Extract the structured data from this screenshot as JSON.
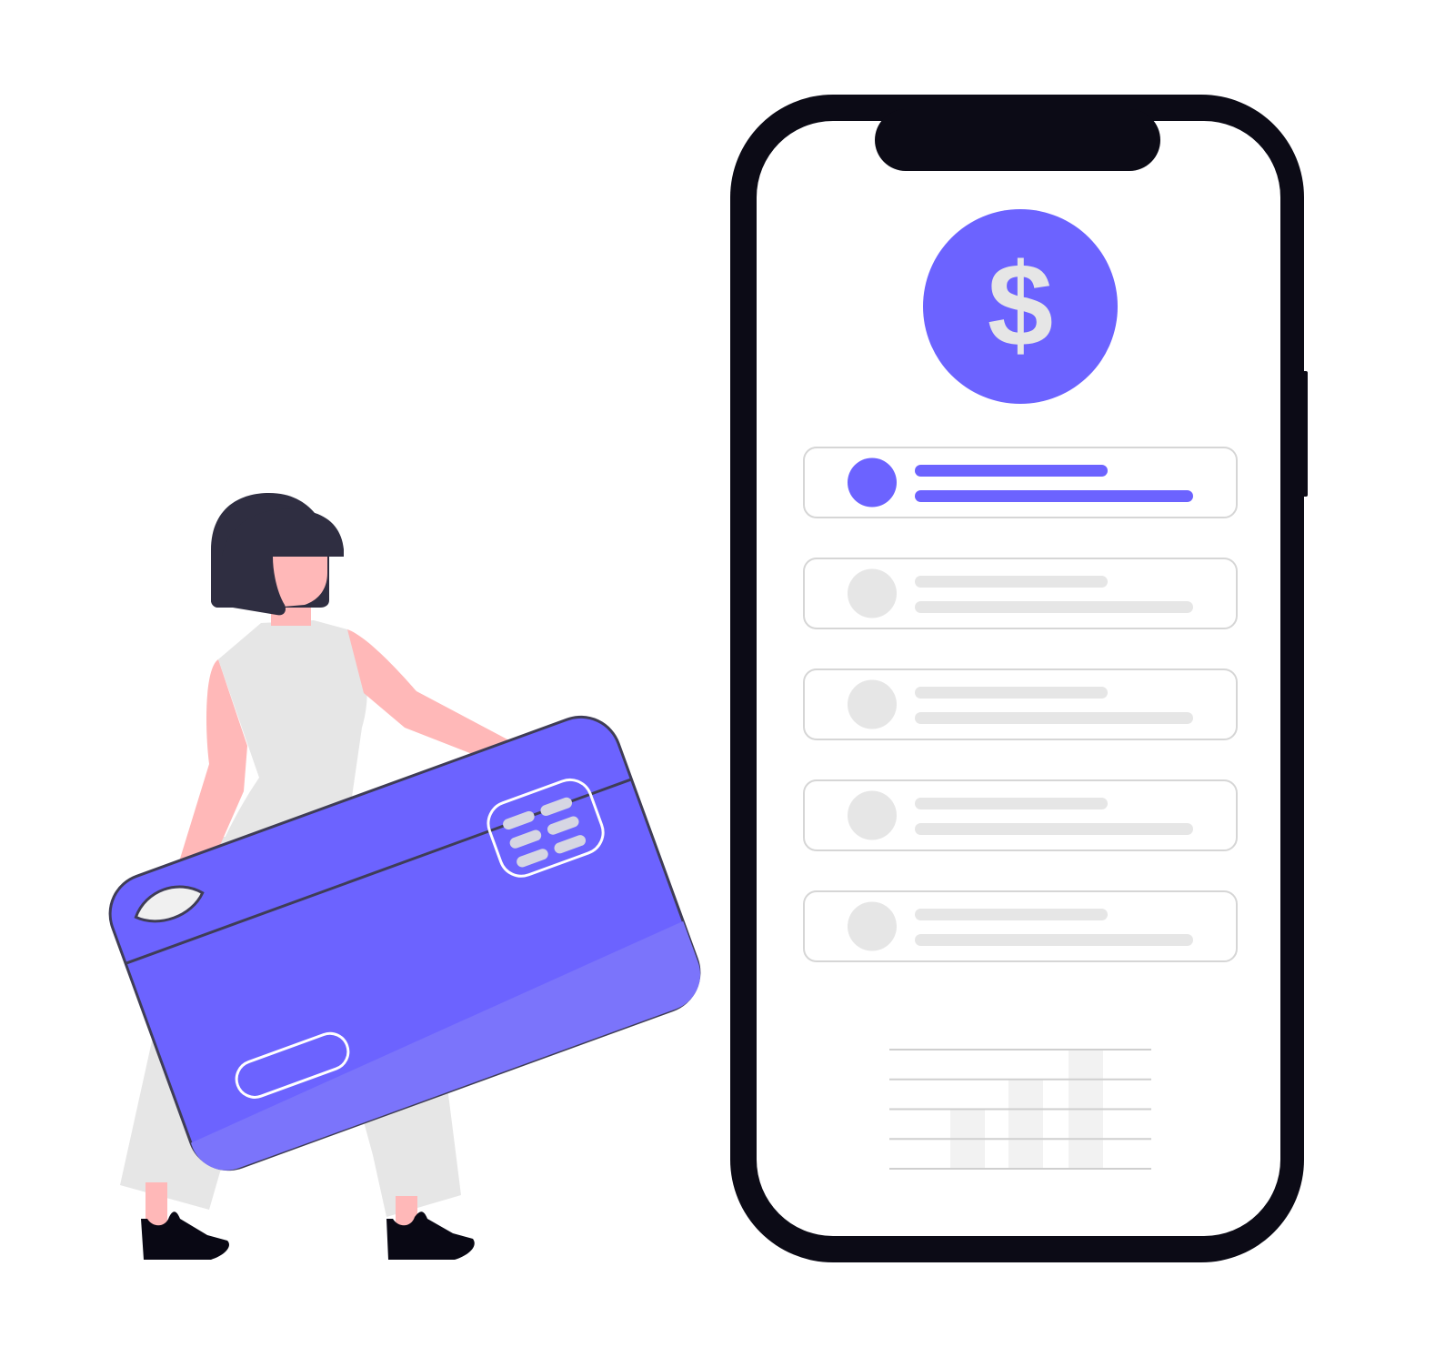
{
  "colors": {
    "accent": "#6c63ff",
    "accent_light": "#7b74fb",
    "phone_frame": "#0c0b16",
    "phone_screen": "#ffffff",
    "placeholder": "#e6e6e6",
    "row_border": "#d6d6d6",
    "hair": "#2f2e41",
    "skin": "#ffb8b8",
    "clothes": "#e6e6e6",
    "shoes": "#090814",
    "chart_bar": "#f2f2f2",
    "chart_grid": "#cfcfcf",
    "chip_bars": "#d6d6e3"
  },
  "phone": {
    "currency_symbol": "$",
    "list_items": [
      {
        "state": "selected"
      },
      {
        "state": "default"
      },
      {
        "state": "default"
      },
      {
        "state": "default"
      },
      {
        "state": "default"
      }
    ],
    "mini_chart": {
      "gridlines": 5,
      "bar_levels": [
        0.5,
        0.75,
        1.0
      ]
    }
  },
  "illustration": {
    "figure": "person-holding-credit-card",
    "card_icon": "credit-card-icon",
    "coin_icon": "dollar-coin-icon"
  }
}
